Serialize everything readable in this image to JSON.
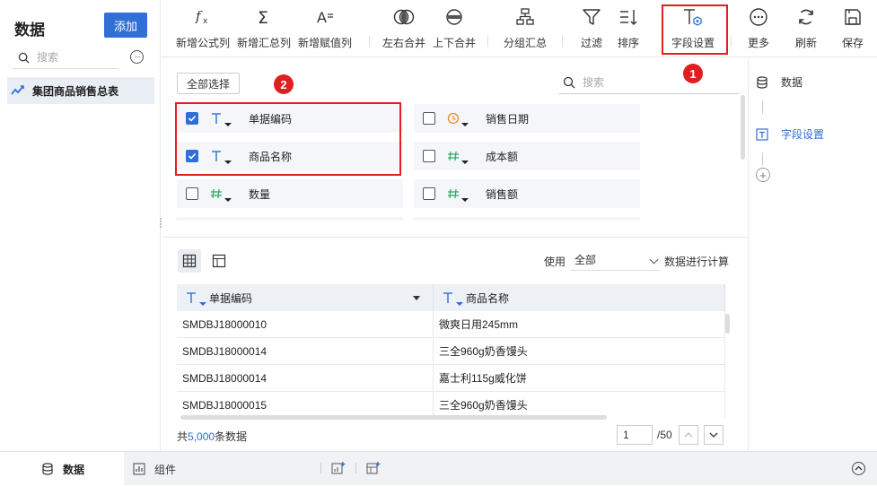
{
  "sidebar": {
    "title": "数据",
    "add_label": "添加",
    "search_placeholder": "搜索",
    "items": [
      {
        "label": "集团商品销售总表"
      }
    ]
  },
  "toolbar": {
    "buttons": [
      {
        "label": "新增公式列",
        "icon": "formula-icon"
      },
      {
        "label": "新增汇总列",
        "icon": "sigma-icon"
      },
      {
        "label": "新增赋值列",
        "icon": "assign-icon"
      },
      {
        "label": "左右合并",
        "icon": "merge-horizontal-icon"
      },
      {
        "label": "上下合并",
        "icon": "merge-vertical-icon"
      },
      {
        "label": "分组汇总",
        "icon": "group-icon"
      },
      {
        "label": "过滤",
        "icon": "filter-icon"
      },
      {
        "label": "排序",
        "icon": "sort-icon"
      },
      {
        "label": "字段设置",
        "icon": "field-settings-icon"
      },
      {
        "label": "更多",
        "icon": "more-icon"
      },
      {
        "label": "刷新",
        "icon": "refresh-icon"
      },
      {
        "label": "保存",
        "icon": "save-icon"
      }
    ],
    "badge_1": "1"
  },
  "field_panel": {
    "select_all_label": "全部选择",
    "search_placeholder": "搜索",
    "badge_2": "2",
    "fields": [
      {
        "name": "单据编码",
        "type": "text",
        "checked": true
      },
      {
        "name": "销售日期",
        "type": "date",
        "checked": false
      },
      {
        "name": "商品名称",
        "type": "text",
        "checked": true
      },
      {
        "name": "成本额",
        "type": "number",
        "checked": false
      },
      {
        "name": "数量",
        "type": "number",
        "checked": false
      },
      {
        "name": "销售额",
        "type": "number",
        "checked": false
      }
    ]
  },
  "preview": {
    "use_label": "使用",
    "use_value": "全部",
    "calc_label": "数据进行计算",
    "columns": [
      "单据编码",
      "商品名称"
    ],
    "rows": [
      [
        "SMDBJ18000010",
        "微爽日用245mm"
      ],
      [
        "SMDBJ18000014",
        "三全960g奶香馒头"
      ],
      [
        "SMDBJ18000014",
        "嘉士利115g威化饼"
      ],
      [
        "SMDBJ18000015",
        "三全960g奶香馒头"
      ]
    ],
    "total_prefix": "共",
    "total_count": "5,000",
    "total_suffix": "条数据",
    "page_value": "1",
    "page_total": "/50"
  },
  "right_panel": {
    "items": [
      {
        "label": "数据"
      },
      {
        "label": "字段设置"
      }
    ]
  },
  "bottom": {
    "tabs": [
      {
        "label": "数据"
      },
      {
        "label": "组件"
      }
    ]
  },
  "colors": {
    "accent": "#2f6fd6",
    "highlight": "#e02020",
    "text_type": "#2f6fd6",
    "date_type": "#f08a24",
    "number_type": "#3aaa6a"
  }
}
